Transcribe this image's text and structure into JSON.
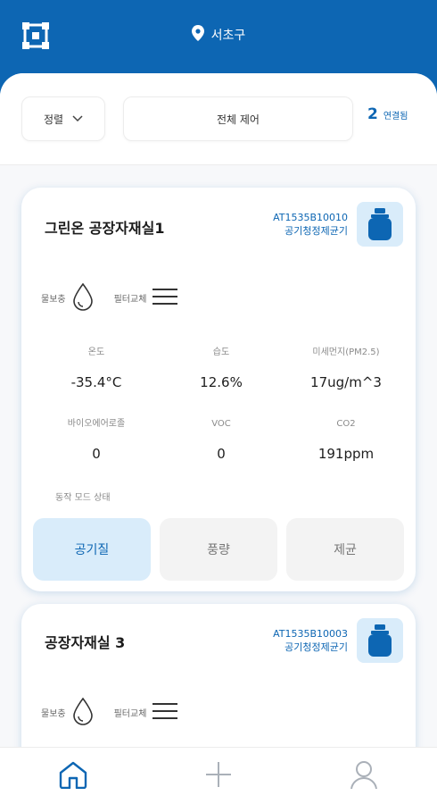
{
  "header": {
    "location": "서초구"
  },
  "controls": {
    "sort_label": "정렬",
    "all_control_label": "전체 제어",
    "connected_count": "2",
    "connected_label": "연결됨"
  },
  "devices": [
    {
      "name": "그린온 공장자재실1",
      "serial": "AT1535B10010",
      "type": "공기청정제균기",
      "water_label": "물보충",
      "filter_label": "필터교체",
      "metrics": [
        {
          "label": "온도",
          "value": "-35.4°C"
        },
        {
          "label": "습도",
          "value": "12.6%"
        },
        {
          "label": "미세먼지(PM2.5)",
          "value": "17ug/m^3"
        },
        {
          "label": "바이오에어로졸",
          "value": "0"
        },
        {
          "label": "VOC",
          "value": "0"
        },
        {
          "label": "CO2",
          "value": "191ppm"
        }
      ],
      "mode_label": "동작 모드 상태",
      "modes": [
        "공기질",
        "풍량",
        "제균"
      ],
      "active_mode": "공기질"
    },
    {
      "name": "공장자재실 3",
      "serial": "AT1535B10003",
      "type": "공기청정제균기",
      "water_label": "물보충",
      "filter_label": "필터교체"
    }
  ],
  "colors": {
    "primary": "#0d66b3",
    "active_bg": "#d9ecfa"
  },
  "icons": {
    "logo": "logo-icon",
    "location": "location-pin-icon",
    "sort": "chevron-down-icon",
    "water": "water-drop-icon",
    "filter": "menu-lines-icon",
    "device": "air-purifier-icon",
    "nav_home": "home-icon",
    "nav_add": "plus-icon",
    "nav_profile": "user-icon"
  }
}
